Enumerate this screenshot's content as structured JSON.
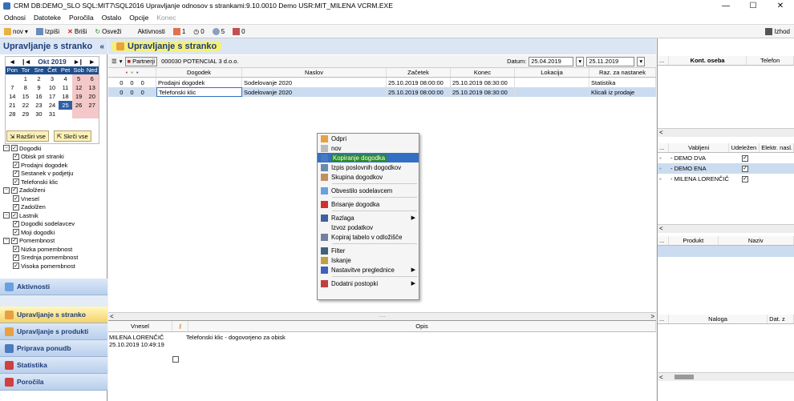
{
  "window": {
    "title": "CRM   DB:DEMO_SLO   SQL:MIT7\\SQL2016   Upravljanje odnosov s strankami:9.10.0010   Demo   USR:MIT_MILENA   VCRM.EXE",
    "min": "—",
    "max": "☐",
    "close": "✕"
  },
  "menu": [
    "Odnosi",
    "Datoteke",
    "Poročila",
    "Ostalo",
    "Opcije",
    "Konec"
  ],
  "toolbar": {
    "nov": "nov",
    "izpisi": "Izpiši",
    "brisi": "Briši",
    "osvezi": "Osveži",
    "aktivnosti": "Aktivnosti",
    "c1": "1",
    "c2": "0",
    "c3": "5",
    "c4": "0",
    "izhod": "Izhod"
  },
  "left": {
    "title": "Upravljanje s stranko",
    "collapse": "«",
    "calendar": {
      "prev2": "◄",
      "prev": "|◄",
      "month": "Okt 2019",
      "next": "►|",
      "next2": "►",
      "days": [
        "Pon",
        "Tor",
        "Sre",
        "Čet",
        "Pet",
        "Sob",
        "Ned"
      ],
      "weeks": [
        [
          "",
          "1",
          "2",
          "3",
          "4",
          "5",
          "6"
        ],
        [
          "7",
          "8",
          "9",
          "10",
          "11",
          "12",
          "13"
        ],
        [
          "14",
          "15",
          "16",
          "17",
          "18",
          "19",
          "20"
        ],
        [
          "21",
          "22",
          "23",
          "24",
          "25",
          "26",
          "27"
        ],
        [
          "28",
          "29",
          "30",
          "31",
          "",
          "",
          ""
        ]
      ]
    },
    "expand_all": "Razširi vse",
    "collapse_all": "Skrči vse",
    "tree": [
      {
        "label": "Dogodki",
        "level": 0,
        "checked": true
      },
      {
        "label": "Obisk pri stranki",
        "level": 1,
        "checked": true
      },
      {
        "label": "Prodajni dogodek",
        "level": 1,
        "checked": true
      },
      {
        "label": "Sestanek v podjetju",
        "level": 1,
        "checked": true
      },
      {
        "label": "Telefonski klic",
        "level": 1,
        "checked": true
      },
      {
        "label": "Zadolženi",
        "level": 0,
        "checked": true
      },
      {
        "label": "Vnesel",
        "level": 1,
        "checked": true
      },
      {
        "label": "Zadolžen",
        "level": 1,
        "checked": true
      },
      {
        "label": "Lastnik",
        "level": 0,
        "checked": true
      },
      {
        "label": "Dogodki sodelavcev",
        "level": 1,
        "checked": true
      },
      {
        "label": "Moji dogodki",
        "level": 1,
        "checked": true
      },
      {
        "label": "Pomembnost",
        "level": 0,
        "checked": true
      },
      {
        "label": "Nizka pomembnost",
        "level": 1,
        "checked": true
      },
      {
        "label": "Srednja pomembnost",
        "level": 1,
        "checked": true
      },
      {
        "label": "Visoka pomembnost",
        "level": 1,
        "checked": true
      }
    ],
    "nav": [
      {
        "label": "Aktivnosti",
        "color": "#6aa0e0",
        "selected": false
      },
      {
        "label": "Upravljanje s stranko",
        "color": "#e8a040",
        "selected": true
      },
      {
        "label": "Upravljanje s produkti",
        "color": "#e8a040",
        "selected": false
      },
      {
        "label": "Priprava ponudb",
        "color": "#4a7ac0",
        "selected": false
      },
      {
        "label": "Statistika",
        "color": "#d04040",
        "selected": false
      },
      {
        "label": "Poročila",
        "color": "#d04040",
        "selected": false
      }
    ]
  },
  "main": {
    "title": "Upravljanje s stranko",
    "partner_button": "Partnerji",
    "partner": "000030 POTENCIAL 3 d.o.o.",
    "datum_label": "Datum:",
    "date_from": "25.04.2019",
    "date_to": "25.11.2019",
    "columns": [
      "Dogodek",
      "Naslov",
      "Začetek",
      "Konec",
      "Lokacija",
      "Raz. za nastanek"
    ],
    "rows": [
      {
        "n1": "0",
        "n2": "0",
        "n3": "0",
        "dogodek": "Prodajni dogodek",
        "naslov": "Sodelovanje 2020",
        "zacetek": "25.10.2019 08:00:00",
        "konec": "25.10.2019 08:30:00",
        "lokacija": "",
        "raz": "Statistika",
        "selected": false
      },
      {
        "n1": "0",
        "n2": "0",
        "n3": "0",
        "dogodek": "Telefonski klic",
        "naslov": "Sodelovanje 2020",
        "zacetek": "25.10.2019 08:00:00",
        "konec": "25.10.2019 08:30:00",
        "lokacija": "",
        "raz": "Klicali iz prodaje",
        "selected": true
      }
    ],
    "context_menu": [
      {
        "label": "Odpri",
        "sub": false,
        "hl": false
      },
      {
        "label": "nov",
        "sub": false,
        "hl": false
      },
      {
        "label": "Kopiranje dogodka",
        "sub": false,
        "hl": true
      },
      {
        "label": "Izpis poslovnih dogodkov",
        "sub": false,
        "hl": false
      },
      {
        "label": "Skupina dogodkov",
        "sub": false,
        "hl": false,
        "sep_after": true
      },
      {
        "label": "Obvestilo sodelavcem",
        "sub": false,
        "hl": false,
        "sep_after": true
      },
      {
        "label": "Brisanje dogodka",
        "sub": false,
        "hl": false,
        "sep_after": true
      },
      {
        "label": "Razlaga",
        "sub": true,
        "hl": false
      },
      {
        "label": "Izvoz podatkov",
        "sub": false,
        "hl": false
      },
      {
        "label": "Kopiraj tabelo v odložišče",
        "sub": false,
        "hl": false,
        "sep_after": true
      },
      {
        "label": "Filter",
        "sub": false,
        "hl": false
      },
      {
        "label": "Iskanje",
        "sub": false,
        "hl": false
      },
      {
        "label": "Nastavitve preglednice",
        "sub": true,
        "hl": false,
        "sep_after": true
      },
      {
        "label": "Dodatni postopki",
        "sub": true,
        "hl": false
      }
    ],
    "detail": {
      "col_vnesel": "Vnesel",
      "col_opis": "Opis",
      "user": "MILENA LORENČIČ",
      "timestamp": "25.10.2019 10:49:19",
      "opis": "Telefonski klic - dogovorjeno za obisk"
    }
  },
  "right": {
    "contacts": {
      "cols": [
        "...",
        "Kont. oseba",
        "Telefon"
      ]
    },
    "invited": {
      "cols": [
        "...",
        "Vabljeni",
        "Udeležen",
        "Elektr. nasl."
      ],
      "rows": [
        {
          "name": "- DEMO DVA",
          "checked": true,
          "sel": false
        },
        {
          "name": "- DEMO ENA",
          "checked": true,
          "sel": true
        },
        {
          "name": "- MILENA LORENČIČ",
          "checked": true,
          "sel": false
        }
      ]
    },
    "products": {
      "cols": [
        "...",
        "Produkt",
        "Naziv"
      ]
    },
    "orders": {
      "cols": [
        "...",
        "Naloga",
        "Dat. z"
      ]
    }
  }
}
